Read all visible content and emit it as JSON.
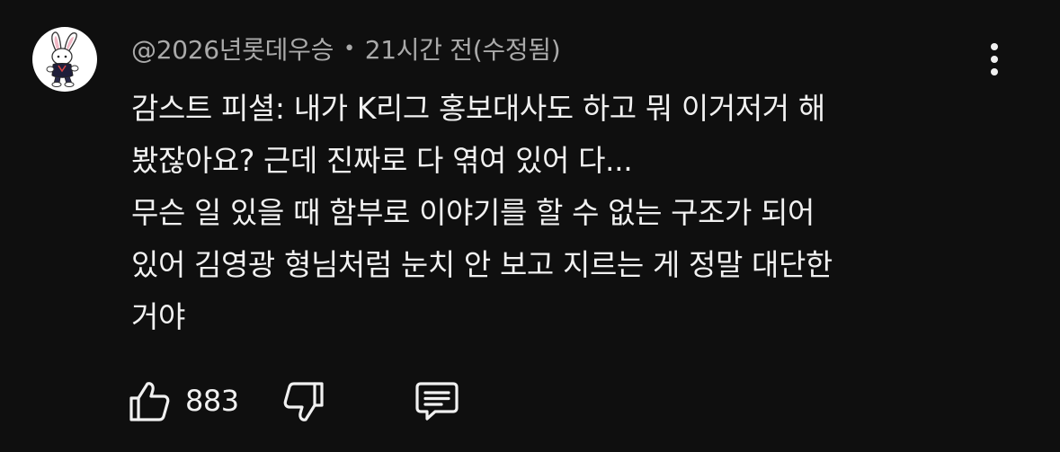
{
  "comment": {
    "author": "@2026년롯데우승",
    "separator": "•",
    "timestamp": "21시간 전(수정됨)",
    "lines": [
      "감스트 피셜: 내가 K리그 홍보대사도 하고 뭐 이거저거 해",
      "봤잖아요? 근데 진짜로 다 엮여 있어 다...",
      "무슨 일 있을 때 함부로 이야기를 할 수 없는 구조가 되어",
      "있어 김영광 형님처럼 눈치 안 보고 지르는 게 정말 대단한",
      "거야"
    ],
    "like_count": "883"
  },
  "icons": {
    "avatar": "rabbit-mascot-avatar",
    "menu": "more-vert-icon",
    "like": "thumbs-up-icon",
    "dislike": "thumbs-down-icon",
    "reply": "comment-bubble-icon"
  },
  "colors": {
    "background": "#0f0f0f",
    "primary_text": "#f1f1f1",
    "secondary_text": "#aaaaaa"
  }
}
